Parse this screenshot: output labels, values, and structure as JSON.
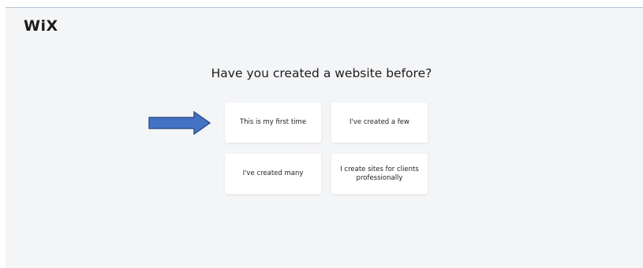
{
  "header": {
    "logo_text": "WiX"
  },
  "main": {
    "question": "Have you created a website before?",
    "options": [
      {
        "label": "This is my first time"
      },
      {
        "label": "I've created a few"
      },
      {
        "label": "I've created many"
      },
      {
        "label": "I create sites for clients professionally"
      }
    ]
  },
  "annotation": {
    "icon": "arrow-right-icon",
    "color": "#4472c4",
    "outline_color": "#2f528f"
  },
  "colors": {
    "background": "#f4f5f7",
    "card": "#ffffff",
    "text": "#1c1c1c"
  }
}
